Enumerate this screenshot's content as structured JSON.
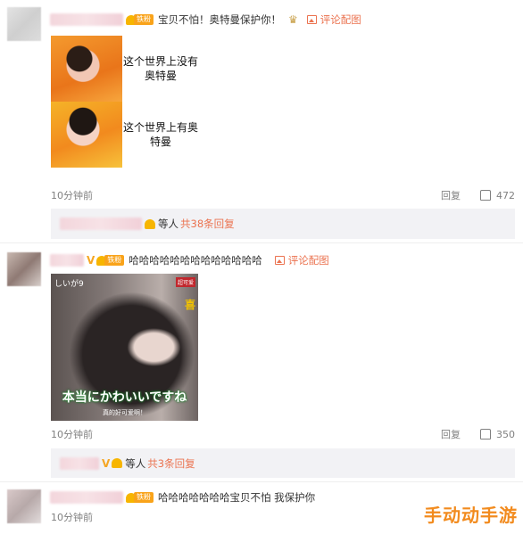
{
  "comments": [
    {
      "badge_tag": "铁粉",
      "text": "宝贝不怕！奥特曼保护你！",
      "pic_link": "评论配图",
      "meme": {
        "top_text": "这个世界上没有奥特曼",
        "bottom_text": "这个世界上有奥特曼"
      },
      "time": "10分钟前",
      "reply_label": "回复",
      "like_count": "472",
      "replies": {
        "etc": "等人",
        "more": "共38条回复"
      }
    },
    {
      "badge_tag": "铁粉",
      "text": "哈哈哈哈哈哈哈哈哈哈哈哈哈",
      "pic_link": "评论配图",
      "screenshot": {
        "corner_text": "しいが9",
        "caption": "本当にかわいいですね",
        "subcaption": "真的好可爱啊！",
        "red_tag": "超可爱",
        "side_char": "喜"
      },
      "time": "10分钟前",
      "reply_label": "回复",
      "like_count": "350",
      "replies": {
        "etc": "等人",
        "more": "共3条回复"
      }
    },
    {
      "badge_tag": "铁粉",
      "text": "哈哈哈哈哈哈哈宝贝不怕 我保护你",
      "time": "10分钟前"
    }
  ],
  "watermark": "手动动手游",
  "colors": {
    "accent": "#eb7350",
    "badge": "#f9a31a",
    "muted": "#808080",
    "reply_bg": "#f2f2f5"
  }
}
